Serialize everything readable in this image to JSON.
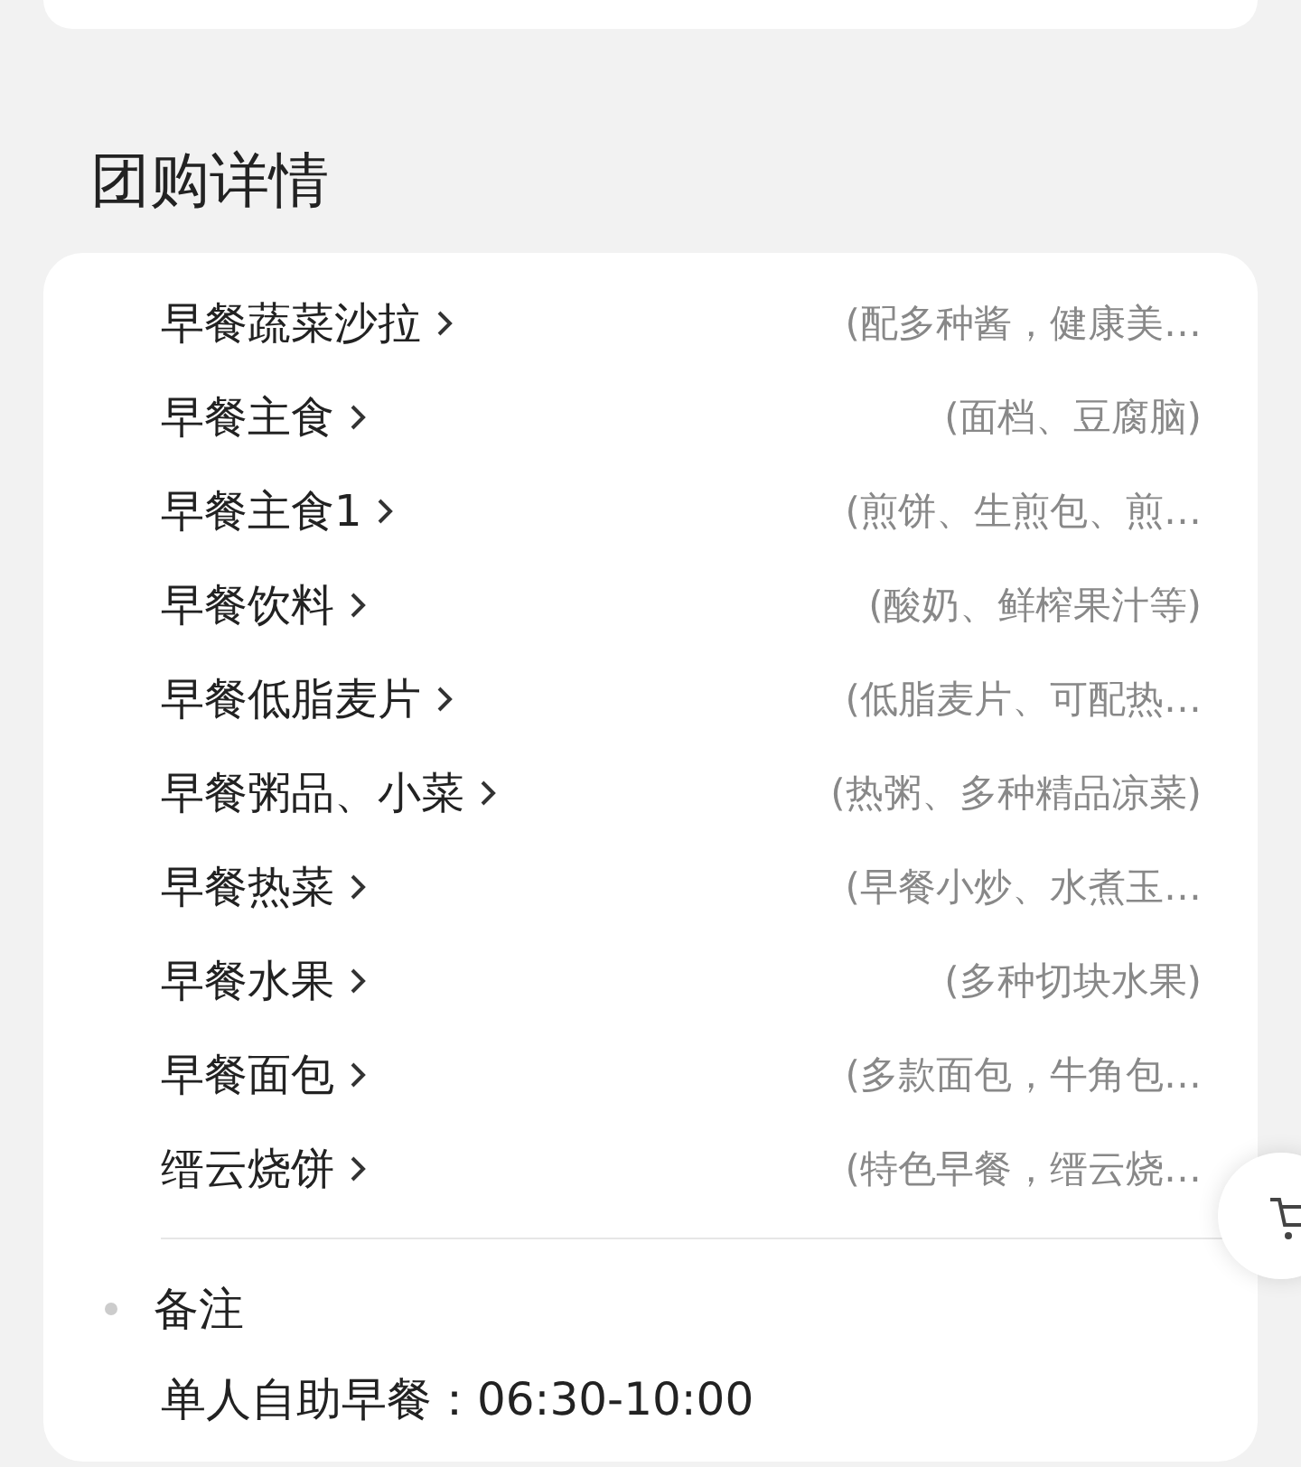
{
  "section_title": "团购详情",
  "items": [
    {
      "name": "早餐蔬菜沙拉",
      "description": "(配多种酱，健康美…"
    },
    {
      "name": "早餐主食",
      "description": "(面档、豆腐脑)"
    },
    {
      "name": "早餐主食1",
      "description": "(煎饼、生煎包、煎…"
    },
    {
      "name": "早餐饮料",
      "description": "(酸奶、鲜榨果汁等)"
    },
    {
      "name": "早餐低脂麦片",
      "description": "(低脂麦片、可配热…"
    },
    {
      "name": "早餐粥品、小菜",
      "description": "(热粥、多种精品凉菜)"
    },
    {
      "name": "早餐热菜",
      "description": "(早餐小炒、水煮玉…"
    },
    {
      "name": "早餐水果",
      "description": "(多种切块水果)"
    },
    {
      "name": "早餐面包",
      "description": "(多款面包，牛角包…"
    },
    {
      "name": "缙云烧饼",
      "description": "(特色早餐，缙云烧…"
    }
  ],
  "note": {
    "title": "备注",
    "text": "单人自助早餐：06:30-10:00"
  }
}
